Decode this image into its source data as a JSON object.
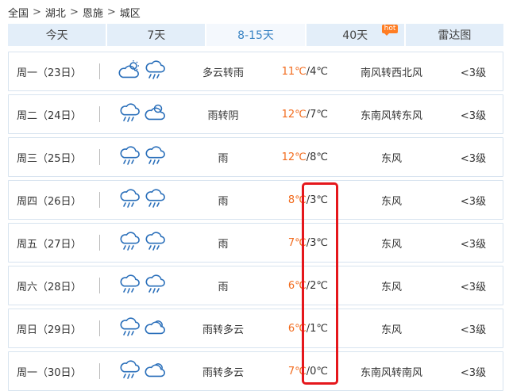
{
  "breadcrumb": [
    "全国",
    "湖北",
    "恩施",
    "城区"
  ],
  "breadcrumb_sep": ">",
  "tabs": [
    {
      "label": "今天",
      "active": false
    },
    {
      "label": "7天",
      "active": false
    },
    {
      "label": "8-15天",
      "active": true
    },
    {
      "label": "40天",
      "active": false,
      "badge": "hot"
    },
    {
      "label": "雷达图",
      "active": false
    }
  ],
  "colors": {
    "high_temp": "#f26b1d",
    "highlight_box": "#e5171c",
    "tab_bg": "#e3eef9",
    "tab_active_text": "#3a84c4",
    "icon_blue": "#2a6fba"
  },
  "forecast": [
    {
      "day": "周一（23日）",
      "icons": [
        "partly-cloudy-sun-icon",
        "rain-icon"
      ],
      "cond": "多云转雨",
      "high": "11℃",
      "low": "4℃",
      "wind": "南风转西北风",
      "level": "<3级"
    },
    {
      "day": "周二（24日）",
      "icons": [
        "rain-icon",
        "cloudy-icon"
      ],
      "cond": "雨转阴",
      "high": "12℃",
      "low": "7℃",
      "wind": "东南风转东风",
      "level": "<3级"
    },
    {
      "day": "周三（25日）",
      "icons": [
        "rain-icon",
        "rain-icon"
      ],
      "cond": "雨",
      "high": "12℃",
      "low": "8℃",
      "wind": "东风",
      "level": "<3级"
    },
    {
      "day": "周四（26日）",
      "icons": [
        "rain-icon",
        "rain-icon"
      ],
      "cond": "雨",
      "high": "8℃",
      "low": "3℃",
      "wind": "东风",
      "level": "<3级"
    },
    {
      "day": "周五（27日）",
      "icons": [
        "rain-icon",
        "rain-icon"
      ],
      "cond": "雨",
      "high": "7℃",
      "low": "3℃",
      "wind": "东风",
      "level": "<3级"
    },
    {
      "day": "周六（28日）",
      "icons": [
        "rain-icon",
        "rain-icon"
      ],
      "cond": "雨",
      "high": "6℃",
      "low": "2℃",
      "wind": "东风",
      "level": "<3级"
    },
    {
      "day": "周日（29日）",
      "icons": [
        "rain-icon",
        "partly-cloudy-icon"
      ],
      "cond": "雨转多云",
      "high": "6℃",
      "low": "1℃",
      "wind": "东风",
      "level": "<3级"
    },
    {
      "day": "周一（30日）",
      "icons": [
        "rain-icon",
        "partly-cloudy-icon"
      ],
      "cond": "雨转多云",
      "high": "7℃",
      "low": "0℃",
      "wind": "东南风转南风",
      "level": "<3级"
    }
  ]
}
